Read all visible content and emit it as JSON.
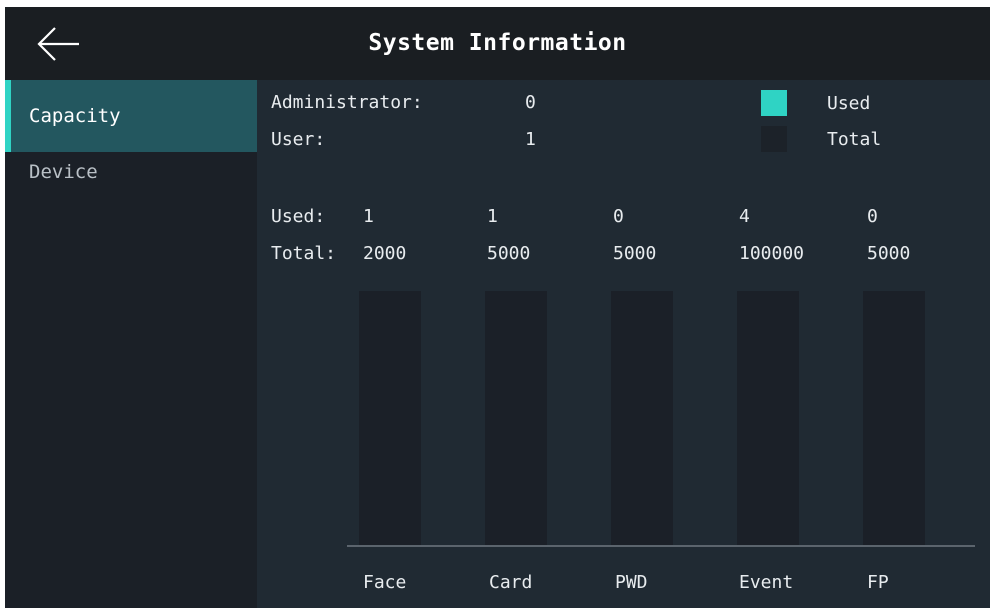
{
  "header": {
    "title": "System Information",
    "back_icon": "arrow-left-icon"
  },
  "sidebar": {
    "items": [
      {
        "label": "Capacity",
        "active": true
      },
      {
        "label": "Device",
        "active": false
      }
    ]
  },
  "summary": {
    "administrator_label": "Administrator:",
    "administrator_value": "0",
    "user_label": "User:",
    "user_value": "1"
  },
  "legend": {
    "used_label": "Used",
    "total_label": "Total",
    "used_color": "#2fd3c4",
    "total_color": "#1c2229"
  },
  "capacity_table": {
    "used_label": "Used:",
    "total_label": "Total:",
    "categories": [
      "Face",
      "Card",
      "PWD",
      "Event",
      "FP"
    ],
    "used": [
      "1",
      "1",
      "0",
      "4",
      "0"
    ],
    "total": [
      "2000",
      "5000",
      "5000",
      "100000",
      "5000"
    ]
  },
  "chart_data": {
    "type": "bar",
    "categories": [
      "Face",
      "Card",
      "PWD",
      "Event",
      "FP"
    ],
    "series": [
      {
        "name": "Used",
        "values": [
          1,
          1,
          0,
          4,
          0
        ]
      },
      {
        "name": "Total",
        "values": [
          2000,
          5000,
          5000,
          100000,
          5000
        ]
      }
    ],
    "title": "",
    "xlabel": "",
    "ylabel": ""
  }
}
